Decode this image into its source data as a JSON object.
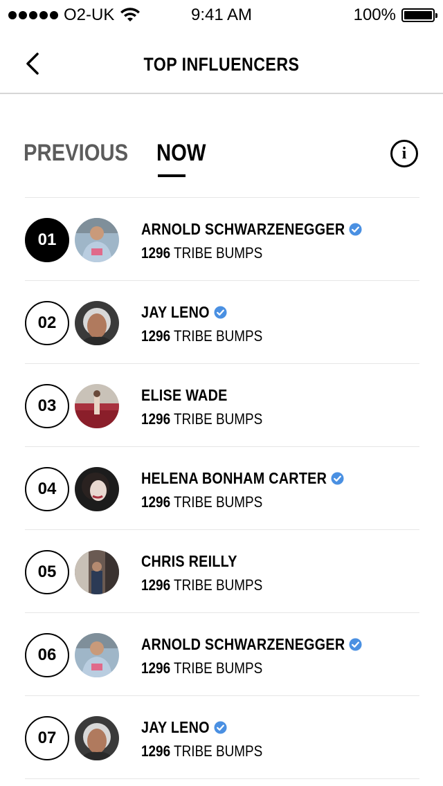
{
  "status_bar": {
    "carrier": "O2-UK",
    "time": "9:41 AM",
    "battery": "100%"
  },
  "header": {
    "title": "TOP INFLUENCERS",
    "back_icon": "chevron-left-icon"
  },
  "tabs": {
    "previous_label": "PREVIOUS",
    "now_label": "NOW",
    "active": "NOW",
    "info_icon": "info-icon"
  },
  "colors": {
    "verified": "#4A90E2",
    "inactive_tab": "#5c5c5c",
    "divider": "#e6e6e6"
  },
  "influencers": [
    {
      "rank": "01",
      "name": "ARNOLD SCHWARZENEGGER",
      "verified": true,
      "count": "1296",
      "unit": "TRIBE BUMPS",
      "active": true
    },
    {
      "rank": "02",
      "name": "JAY LENO",
      "verified": true,
      "count": "1296",
      "unit": "TRIBE BUMPS",
      "active": false
    },
    {
      "rank": "03",
      "name": "ELISE WADE",
      "verified": false,
      "count": "1296",
      "unit": "TRIBE BUMPS",
      "active": false
    },
    {
      "rank": "04",
      "name": "HELENA BONHAM CARTER",
      "verified": true,
      "count": "1296",
      "unit": "TRIBE BUMPS",
      "active": false
    },
    {
      "rank": "05",
      "name": "CHRIS REILLY",
      "verified": false,
      "count": "1296",
      "unit": "TRIBE BUMPS",
      "active": false
    },
    {
      "rank": "06",
      "name": "ARNOLD SCHWARZENEGGER",
      "verified": true,
      "count": "1296",
      "unit": "TRIBE BUMPS",
      "active": false
    },
    {
      "rank": "07",
      "name": "JAY LENO",
      "verified": true,
      "count": "1296",
      "unit": "TRIBE BUMPS",
      "active": false
    }
  ]
}
